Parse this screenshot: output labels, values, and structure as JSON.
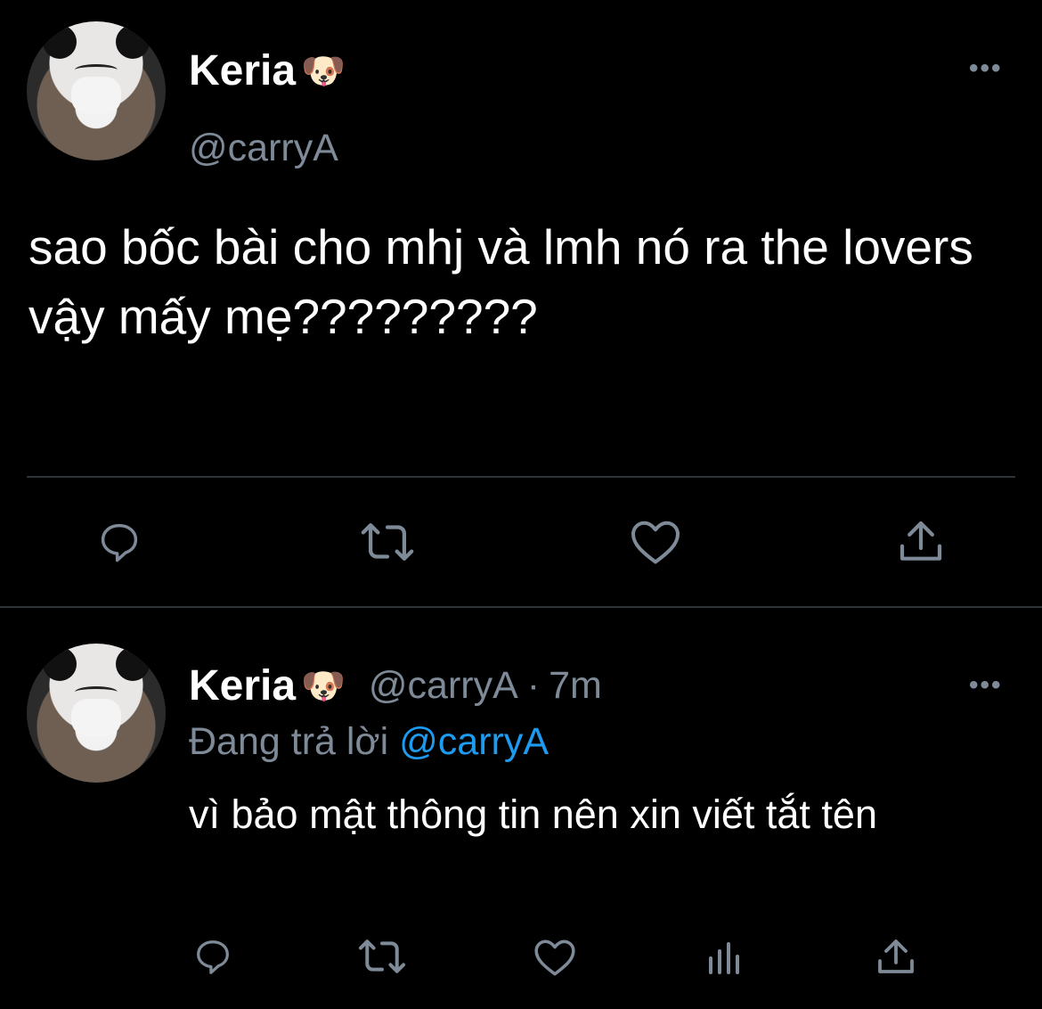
{
  "tweet": {
    "author": {
      "name": "Keria",
      "name_emoji": "🐶",
      "handle": "@carryA",
      "avatar": "avatar"
    },
    "more": "•••",
    "text": "sao bốc bài cho mhj và lmh nó ra the lovers vậy mấy mẹ?????????",
    "actions": [
      "reply-icon",
      "retweet-icon",
      "like-icon",
      "share-icon"
    ]
  },
  "reply": {
    "author": {
      "name": "Keria",
      "name_emoji": "🐶",
      "handle": "@carryA",
      "time_sep": "·",
      "time": "7m"
    },
    "more": "•••",
    "replying_prefix": "Đang trả lời",
    "replying_to": "@carryA",
    "text": "vì bảo mật thông tin nên xin viết tắt tên",
    "actions": [
      "reply-icon",
      "retweet-icon",
      "like-icon",
      "analytics-icon",
      "share-icon"
    ]
  },
  "colors": {
    "background": "#000000",
    "text": "#ffffff",
    "secondary": "#7e8a97",
    "link": "#1d9bf0",
    "divider": "#2f3336"
  }
}
